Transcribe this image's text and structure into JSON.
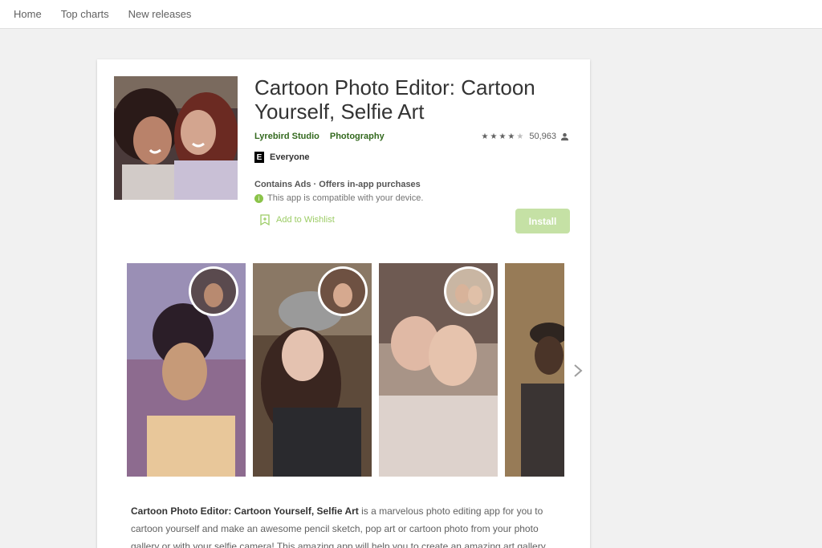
{
  "nav": {
    "items": [
      "Home",
      "Top charts",
      "New releases"
    ]
  },
  "app": {
    "title": "Cartoon Photo Editor: Cartoon Yourself, Selfie Art",
    "developer": "Lyrebird Studio",
    "category": "Photography",
    "rating_count": "50,963",
    "stars": 4,
    "content_rating_badge": "E",
    "content_rating": "Everyone",
    "ads_info": "Contains Ads · Offers in-app purchases",
    "compatibility": "This app is compatible with your device.",
    "wishlist_label": "Add to Wishlist",
    "install_label": "Install"
  },
  "description": {
    "bold": "Cartoon Photo Editor: Cartoon Yourself, Selfie Art",
    "text": " is a marvelous photo editing app for you to cartoon yourself and make an awesome pencil sketch, pop art or cartoon photo from your photo gallery or with your selfie camera! This amazing app will help you to create an amazing art gallery"
  },
  "colors": {
    "accent": "#33691e",
    "install_bg": "#c5e1a5",
    "wishlist": "#9ccc65"
  }
}
